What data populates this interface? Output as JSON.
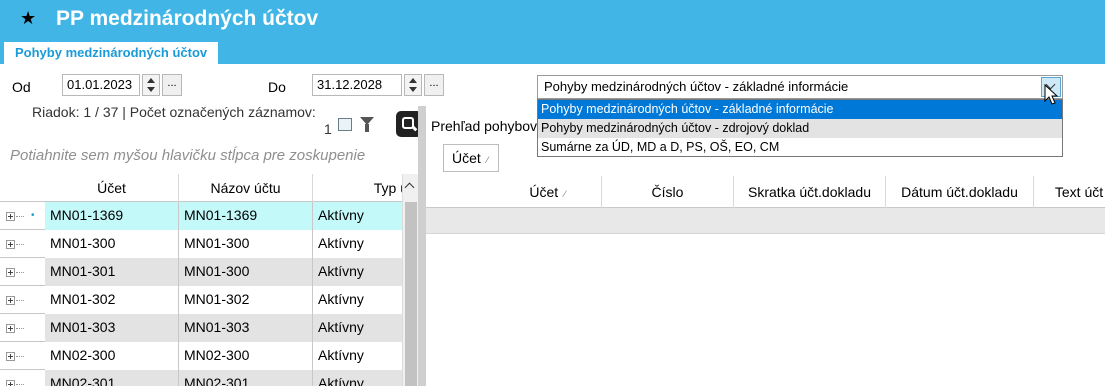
{
  "app": {
    "title": "PP medzinárodných účtov",
    "star": "★"
  },
  "tabs": [
    {
      "label": "Pohyby medzinárodných účtov"
    }
  ],
  "filters": {
    "od_label": "Od",
    "od_value": "01.01.2023",
    "do_label": "Do",
    "do_value": "31.12.2028",
    "ellipsis": "..."
  },
  "view_select": {
    "value": "Pohyby medzinárodných účtov - základné informácie",
    "options": [
      "Pohyby medzinárodných účtov - základné informácie",
      "Pohyby medzinárodných účtov - zdrojový doklad",
      "Sumárne za ÚD, MD a D, PS, OŠ, EO, CM"
    ]
  },
  "left_panel": {
    "status": "Riadok: 1 / 37 | Počet označených záznamov:",
    "count": "1",
    "group_hint": "Potiahnite sem myšou hlavičku stĺpca pre zoskupenie",
    "columns": [
      "Účet",
      "Názov účtu",
      "Typ ú"
    ],
    "rows": [
      [
        "MN01-1369",
        "MN01-1369",
        "Aktívny"
      ],
      [
        "MN01-300",
        "MN01-300",
        "Aktívny"
      ],
      [
        "MN01-301",
        "MN01-300",
        "Aktívny"
      ],
      [
        "MN01-302",
        "MN01-302",
        "Aktívny"
      ],
      [
        "MN01-303",
        "MN01-303",
        "Aktívny"
      ],
      [
        "MN02-300",
        "MN02-300",
        "Aktívny"
      ],
      [
        "MN02-301",
        "MN02-301",
        "Aktívny"
      ]
    ]
  },
  "right_panel": {
    "title": "Prehľad pohybov",
    "group_chip": "Účet",
    "columns": [
      "Účet",
      "Číslo",
      "Skratka účt.dokladu",
      "Dátum účt.dokladu",
      "Text účt"
    ]
  }
}
